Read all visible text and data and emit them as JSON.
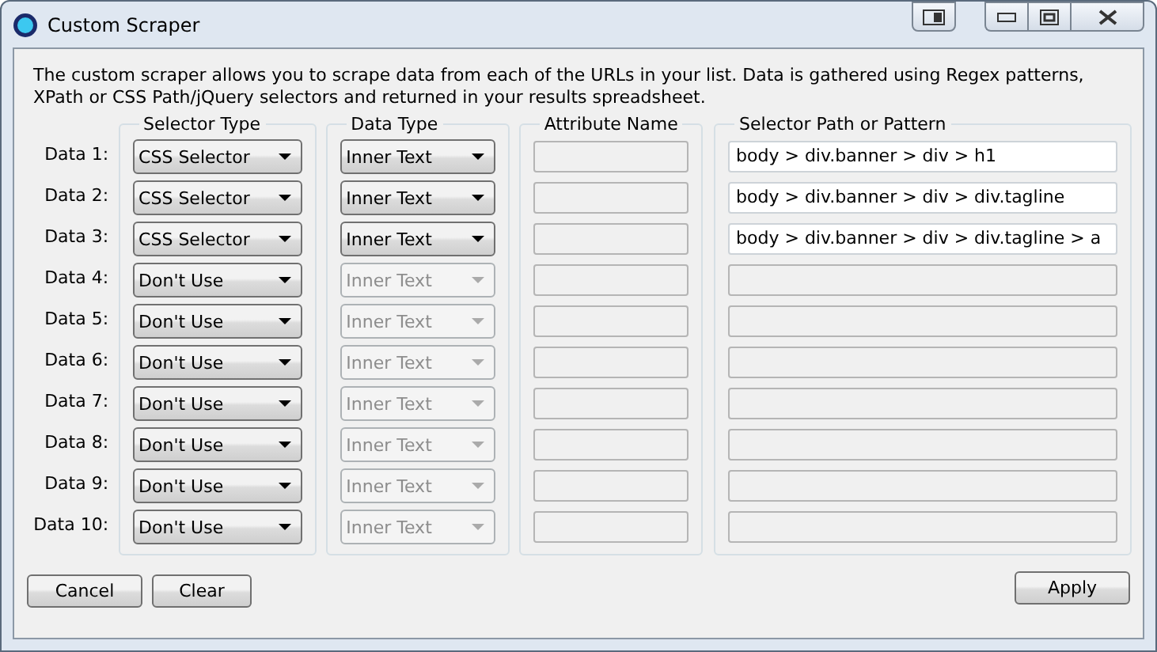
{
  "window": {
    "title": "Custom Scraper"
  },
  "description": "The custom scraper allows you to scrape data from each of the URLs in your list. Data is gathered using Regex patterns, XPath or CSS Path/jQuery selectors and returned in your results spreadsheet.",
  "columns": [
    "Selector Type",
    "Data Type",
    "Attribute Name",
    "Selector Path or Pattern"
  ],
  "rows": [
    {
      "label": "Data 1:",
      "selector": "CSS Selector",
      "data_type": "Inner Text",
      "data_type_disabled": false,
      "attribute_disabled": true,
      "path": "body > div.banner > div > h1",
      "path_disabled": false
    },
    {
      "label": "Data 2:",
      "selector": "CSS Selector",
      "data_type": "Inner Text",
      "data_type_disabled": false,
      "attribute_disabled": true,
      "path": "body > div.banner > div > div.tagline",
      "path_disabled": false
    },
    {
      "label": "Data 3:",
      "selector": "CSS Selector",
      "data_type": "Inner Text",
      "data_type_disabled": false,
      "attribute_disabled": true,
      "path": "body > div.banner > div > div.tagline > a",
      "path_disabled": false
    },
    {
      "label": "Data 4:",
      "selector": "Don't Use",
      "data_type": "Inner Text",
      "data_type_disabled": true,
      "attribute_disabled": true,
      "path_disabled": true
    },
    {
      "label": "Data 5:",
      "selector": "Don't Use",
      "data_type": "Inner Text",
      "data_type_disabled": true,
      "attribute_disabled": true,
      "path_disabled": true
    },
    {
      "label": "Data 6:",
      "selector": "Don't Use",
      "data_type": "Inner Text",
      "data_type_disabled": true,
      "attribute_disabled": true,
      "path_disabled": true
    },
    {
      "label": "Data 7:",
      "selector": "Don't Use",
      "data_type": "Inner Text",
      "data_type_disabled": true,
      "attribute_disabled": true,
      "path_disabled": true
    },
    {
      "label": "Data 8:",
      "selector": "Don't Use",
      "data_type": "Inner Text",
      "data_type_disabled": true,
      "attribute_disabled": true,
      "path_disabled": true
    },
    {
      "label": "Data 9:",
      "selector": "Don't Use",
      "data_type": "Inner Text",
      "data_type_disabled": true,
      "attribute_disabled": true,
      "path_disabled": true
    },
    {
      "label": "Data 10:",
      "selector": "Don't Use",
      "data_type": "Inner Text",
      "data_type_disabled": true,
      "attribute_disabled": true,
      "path_disabled": true
    }
  ],
  "buttons_left": [
    "Cancel",
    "Clear"
  ],
  "button_right": "Apply"
}
